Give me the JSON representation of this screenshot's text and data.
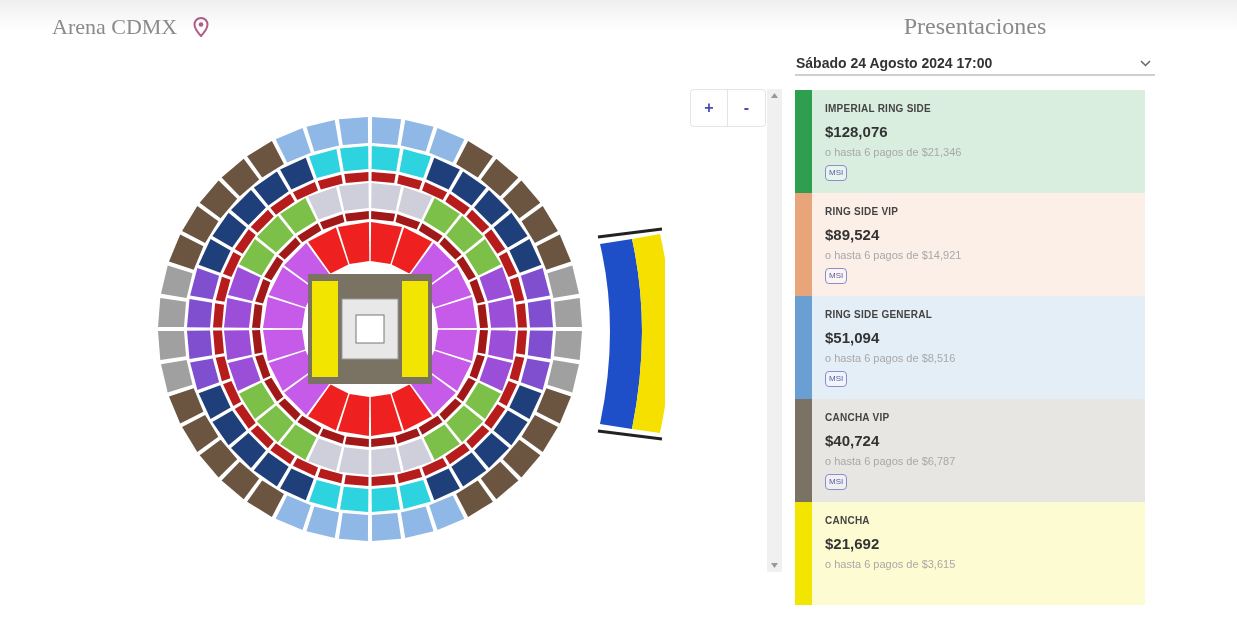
{
  "venue": {
    "name": "Arena CDMX"
  },
  "zoom_controls": [
    {
      "label": "+"
    },
    {
      "label": "-"
    }
  ],
  "presentations": {
    "title": "Presentaciones",
    "date_select": {
      "value": "Sábado 24 Agosto 2024 17:00"
    },
    "zones": [
      {
        "name": "IMPERIAL RING SIDE",
        "price": "$128,076",
        "installments": "o hasta 6 pagos de $21,346",
        "badge": "MSI",
        "color": "#2e9e4f"
      },
      {
        "name": "RING SIDE VIP",
        "price": "$89,524",
        "installments": "o hasta 6 pagos de $14,921",
        "badge": "MSI",
        "color": "#e8a57a"
      },
      {
        "name": "RING SIDE GENERAL",
        "price": "$51,094",
        "installments": "o hasta 6 pagos de $8,516",
        "badge": "MSI",
        "color": "#6a9fd4"
      },
      {
        "name": "CANCHA VIP",
        "price": "$40,724",
        "installments": "o hasta 6 pagos de $6,787",
        "badge": "MSI",
        "color": "#7a7262"
      },
      {
        "name": "CANCHA",
        "price": "$21,692",
        "installments": "o hasta 6 pagos de $3,615",
        "color": "#f2e600"
      }
    ]
  }
}
